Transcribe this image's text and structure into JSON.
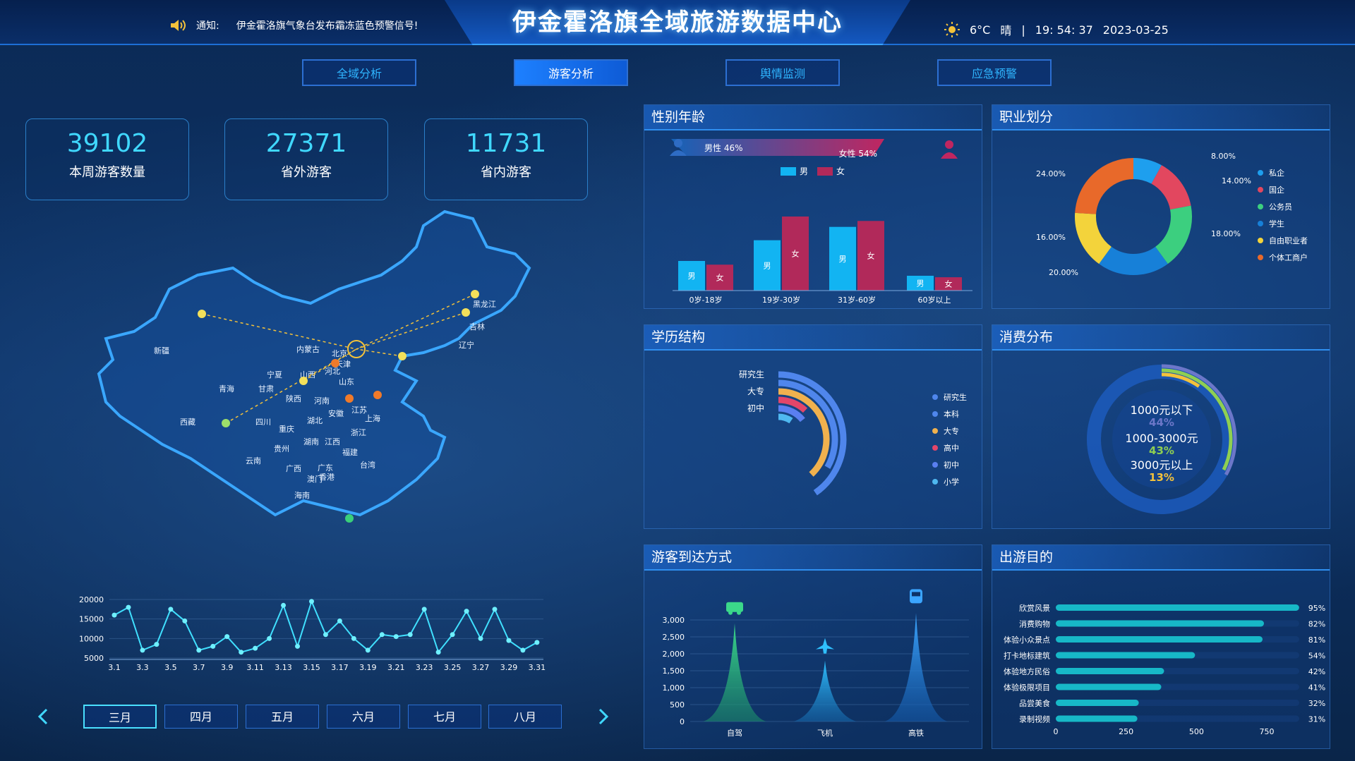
{
  "header": {
    "title": "伊金霍洛旗全域旅游数据中心",
    "notice_label": "通知:",
    "notice_text": "伊金霍洛旗气象台发布霜冻蓝色预警信号!",
    "temperature": "6°C",
    "weather": "晴",
    "separator": "|",
    "time": "19: 54: 37",
    "date": "2023-03-25",
    "icons": {
      "notice": "speaker-icon",
      "weather": "sun-icon"
    }
  },
  "tabs": [
    {
      "label": "全域分析",
      "active": false
    },
    {
      "label": "游客分析",
      "active": true
    },
    {
      "label": "舆情监测",
      "active": false
    },
    {
      "label": "应急预警",
      "active": false
    }
  ],
  "stats": [
    {
      "value": "39102",
      "label": "本周游客数量"
    },
    {
      "value": "27371",
      "label": "省外游客"
    },
    {
      "value": "11731",
      "label": "省内游客"
    }
  ],
  "map": {
    "provinces": [
      "黑龙江",
      "吉林",
      "辽宁",
      "内蒙古",
      "北京",
      "天津",
      "河北",
      "山西",
      "山东",
      "宁夏",
      "甘肃",
      "青海",
      "新疆",
      "西藏",
      "陕西",
      "河南",
      "江苏",
      "安徽",
      "上海",
      "湖北",
      "浙江",
      "四川",
      "重庆",
      "湖南",
      "江西",
      "福建",
      "贵州",
      "云南",
      "广西",
      "广东",
      "台湾",
      "香港",
      "澳门",
      "海南"
    ]
  },
  "daily_chart": {
    "y_ticks": [
      "20000",
      "15000",
      "10000",
      "5000"
    ],
    "x_ticks": [
      "3.1",
      "3.3",
      "3.5",
      "3.7",
      "3.9",
      "3.11",
      "3.13",
      "3.15",
      "3.17",
      "3.19",
      "3.21",
      "3.23",
      "3.25",
      "3.27",
      "3.29",
      "3.31"
    ],
    "values": [
      16000,
      18000,
      7000,
      8500,
      17500,
      14500,
      7000,
      8000,
      10500,
      6500,
      7500,
      10000,
      18500,
      8000,
      19500,
      11000,
      14500,
      10000,
      7000,
      11000,
      10500,
      11000,
      17500,
      6500,
      11000,
      17000,
      10000,
      17500,
      9500,
      7000,
      9000
    ]
  },
  "months": [
    {
      "label": "三月",
      "active": true
    },
    {
      "label": "四月",
      "active": false
    },
    {
      "label": "五月",
      "active": false
    },
    {
      "label": "六月",
      "active": false
    },
    {
      "label": "七月",
      "active": false
    },
    {
      "label": "八月",
      "active": false
    }
  ],
  "gender_age": {
    "title": "性别年龄",
    "male_label": "男性 46%",
    "female_label": "女性 54%",
    "legend": [
      "男",
      "女"
    ],
    "bar_male": "男",
    "bar_female": "女",
    "chart_data": {
      "type": "bar",
      "categories": [
        "0岁-18岁",
        "19岁-30岁",
        "31岁-60岁",
        "60岁以上"
      ],
      "series": [
        {
          "name": "男",
          "values": [
            40,
            68,
            86,
            20
          ],
          "color": "#12b4f2"
        },
        {
          "name": "女",
          "values": [
            35,
            100,
            94,
            18
          ],
          "color": "#b1295a"
        }
      ]
    }
  },
  "occupation": {
    "title": "职业划分",
    "chart_data": {
      "type": "pie",
      "categories": [
        "私企",
        "国企",
        "公务员",
        "学生",
        "自由职业者",
        "个体工商户"
      ],
      "values": [
        8,
        14,
        18,
        20,
        16,
        24
      ],
      "labels": [
        "8.00%",
        "14.00%",
        "18.00%",
        "20.00%",
        "16.00%",
        "24.00%"
      ],
      "colors": [
        "#1e9fee",
        "#e2475f",
        "#3ccf7f",
        "#1780d8",
        "#f3d33b",
        "#e8692a"
      ]
    }
  },
  "education": {
    "title": "学历结构",
    "chart_data": {
      "type": "pie",
      "categories": [
        "研究生",
        "本科",
        "大专",
        "高中",
        "初中",
        "小学"
      ],
      "axis_labels": [
        "研究生",
        "大专",
        "初中"
      ],
      "colors": [
        "#4f86ec",
        "#4f86ec",
        "#f0b14e",
        "#e3466a",
        "#5a7ff0",
        "#4fb8f0"
      ],
      "values": [
        85,
        70,
        80,
        25,
        30,
        20
      ]
    }
  },
  "consumption": {
    "title": "消费分布",
    "chart_data": {
      "type": "pie",
      "categories": [
        "1000元以下",
        "1000-3000元",
        "3000元以上"
      ],
      "values": [
        44,
        43,
        13
      ],
      "labels": [
        "44%",
        "43%",
        "13%"
      ],
      "colors": [
        "#6c77c9",
        "#8fcf52",
        "#f3c23b"
      ]
    }
  },
  "arrival": {
    "title": "游客到达方式",
    "chart_data": {
      "type": "area",
      "categories": [
        "自驾",
        "飞机",
        "高铁"
      ],
      "values": [
        2900,
        1800,
        3200
      ],
      "y_ticks": [
        "3,000",
        "2,500",
        "2,000",
        "1,500",
        "1,000",
        "500",
        "0"
      ],
      "ylim": [
        0,
        3000
      ],
      "icons": [
        "car-icon",
        "airplane-icon",
        "train-icon"
      ]
    }
  },
  "purpose": {
    "title": "出游目的",
    "chart_data": {
      "type": "bar",
      "categories": [
        "欣赏风景",
        "消费购物",
        "体验小众景点",
        "打卡地标建筑",
        "体验地方民俗",
        "体验极限项目",
        "品尝美食",
        "录制视频"
      ],
      "values": [
        865,
        740,
        735,
        495,
        385,
        375,
        295,
        290
      ],
      "labels": [
        "95%",
        "82%",
        "81%",
        "54%",
        "42%",
        "41%",
        "32%",
        "31%"
      ],
      "x_ticks": [
        "0",
        "250",
        "500",
        "750"
      ],
      "xlim": [
        0,
        900
      ]
    }
  }
}
